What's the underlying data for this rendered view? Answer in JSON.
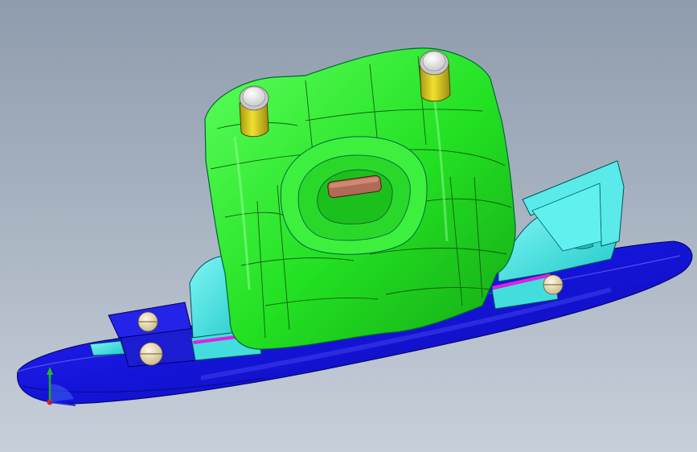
{
  "viewport": {
    "background_top": "#8f9cad",
    "background_bottom": "#c7cfda"
  },
  "model": {
    "parts": [
      {
        "name": "base-plate",
        "color": "#1a1adc"
      },
      {
        "name": "slider-blocks",
        "color": "#33e6e6"
      },
      {
        "name": "core-insert",
        "color": "#22e022"
      },
      {
        "name": "guide-pins",
        "color": "#e0d020"
      },
      {
        "name": "center-slot",
        "color": "#b06a58"
      },
      {
        "name": "edge-strips",
        "color": "#e020e0"
      },
      {
        "name": "screws",
        "color": "#e8dcb0"
      }
    ]
  },
  "triad": {
    "axes": [
      {
        "name": "y",
        "color": "#20c020"
      },
      {
        "name": "x",
        "color": "#e02020"
      },
      {
        "name": "z",
        "color": "#2030e0"
      }
    ]
  }
}
